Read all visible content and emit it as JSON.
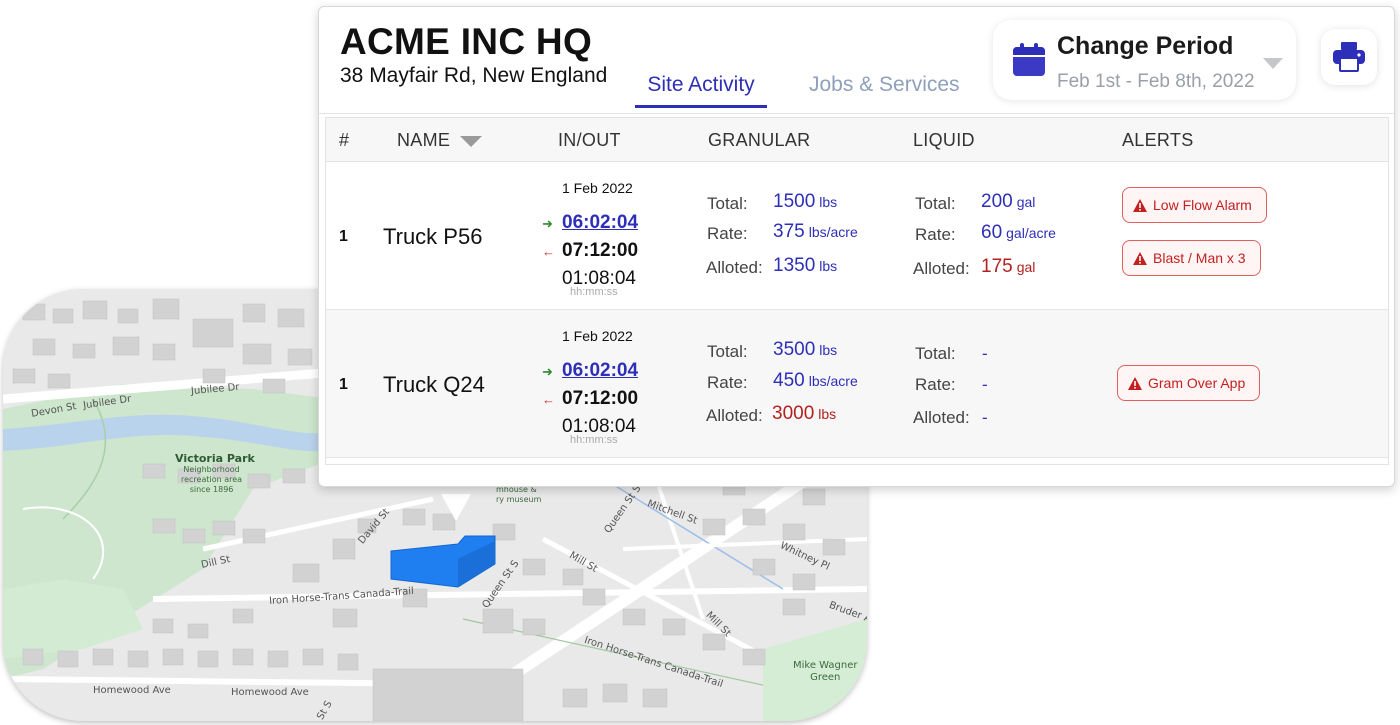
{
  "site": {
    "title": "ACME INC HQ",
    "address": "38 Mayfair Rd, New England"
  },
  "tabs": [
    {
      "label": "Site Activity",
      "active": true
    },
    {
      "label": "Jobs & Services",
      "active": false
    }
  ],
  "period": {
    "title": "Change Period",
    "range": "Feb 1st - Feb 8th, 2022",
    "icon": "calendar-icon"
  },
  "print": {
    "icon": "printer-icon"
  },
  "table": {
    "headers": [
      "#",
      "NAME",
      "IN/OUT",
      "GRANULAR",
      "LIQUID",
      "ALERTS"
    ],
    "labels": {
      "total": "Total:",
      "rate": "Rate:",
      "alloted": "Alloted:",
      "hms": "hh:mm:ss"
    },
    "rows": [
      {
        "num": "1",
        "name": "Truck P56",
        "date": "1 Feb 2022",
        "in_time": "06:02:04",
        "out_time": "07:12:00",
        "duration": "01:08:04",
        "granular": {
          "total": "1500",
          "total_unit": "lbs",
          "rate": "375",
          "rate_unit": "lbs/acre",
          "alloted": "1350",
          "alloted_unit": "lbs"
        },
        "liquid": {
          "total": "200",
          "total_unit": "gal",
          "rate": "60",
          "rate_unit": "gal/acre",
          "alloted": "175",
          "alloted_unit": "gal"
        },
        "alerts": [
          "Low Flow Alarm",
          "Blast / Man x 3"
        ]
      },
      {
        "num": "1",
        "name": "Truck Q24",
        "date": "1 Feb 2022",
        "in_time": "06:02:04",
        "out_time": "07:12:00",
        "duration": "01:08:04",
        "granular": {
          "total": "3500",
          "total_unit": "lbs",
          "rate": "450",
          "rate_unit": "lbs/acre",
          "alloted": "3000",
          "alloted_unit": "lbs"
        },
        "liquid": {
          "total": "-",
          "rate": "-",
          "alloted": "-"
        },
        "alerts": [
          "Gram Over App"
        ]
      }
    ]
  },
  "map": {
    "streets": [
      "Devon St",
      "Jubilee Dr",
      "Jubilee Dr",
      "Dill St",
      "David St",
      "Iron Horse-Trans Canada-Trail",
      "Queen St S",
      "Queen St S",
      "Mitchell St",
      "Mill St",
      "Mill St",
      "Whitney Pl",
      "Bruder A",
      "Iron Horse-Trans Canada-Trail",
      "Homewood Ave",
      "Homewood Ave",
      "St S"
    ],
    "park_name": "Victoria Park",
    "park_sub": [
      "Neighborhood",
      "recreation area",
      "since 1896"
    ],
    "museum": [
      "mhouse &",
      "ry museum"
    ],
    "green_name": [
      "Mike Wagner",
      "Green"
    ],
    "colors": {
      "water": "#b9d3ec",
      "park": "#cde6cd",
      "building": "#d4d4d4",
      "highlight": "#1f7ef0"
    }
  },
  "colors": {
    "accent": "#2e2fb8",
    "alert": "#c42020",
    "in_arrow": "#2e8b2e",
    "out_arrow": "#c23030"
  }
}
